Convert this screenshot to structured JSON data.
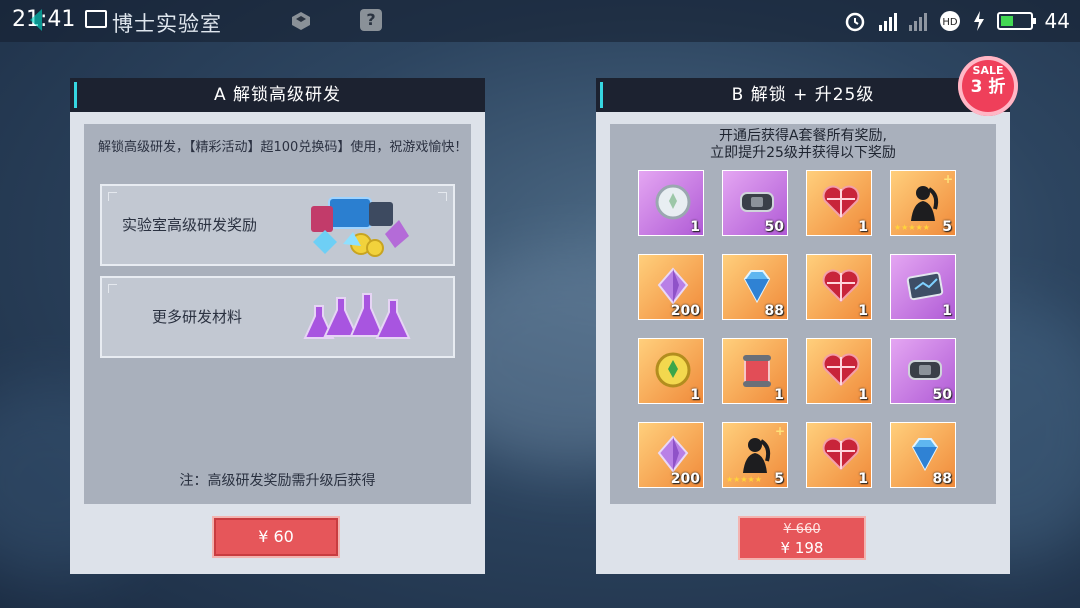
{
  "status_bar": {
    "time": "21:41",
    "app_title": "博士实验室",
    "battery": "44",
    "battery_level": 0.44
  },
  "panel_a": {
    "title": "A 解锁高级研发",
    "description": "解锁高级研发，【精彩活动】超100兑换码】使用，祝游戏愉快！",
    "rewards": [
      {
        "label": "实验室高级研发奖励"
      },
      {
        "label": "更多研发材料"
      }
    ],
    "note": "注：高级研发奖励需升级后获得",
    "price": "¥ 60"
  },
  "panel_b": {
    "title": "B 解锁 + 升25级",
    "description_line1": "开通后获得A套餐所有奖励,",
    "description_line2": "立即提升25级并获得以下奖励",
    "sale_label": "SALE",
    "sale_value": "3 折",
    "price_old": "¥ 660",
    "price_new": "¥ 198",
    "items": [
      {
        "icon": "silver-clover-coin-icon",
        "qty": "1",
        "bg": "purple"
      },
      {
        "icon": "gear-part-icon",
        "qty": "50",
        "bg": "purple"
      },
      {
        "icon": "heart-gift-box-icon",
        "qty": "1",
        "bg": "orange"
      },
      {
        "icon": "character-silhouette-icon",
        "qty": "5",
        "bg": "orange",
        "stars": "★★★★★"
      },
      {
        "icon": "purple-crystal-icon",
        "qty": "200",
        "bg": "orange"
      },
      {
        "icon": "blue-diamond-icon",
        "qty": "88",
        "bg": "orange"
      },
      {
        "icon": "heart-gift-box-icon",
        "qty": "1",
        "bg": "orange"
      },
      {
        "icon": "data-card-icon",
        "qty": "1",
        "bg": "purple"
      },
      {
        "icon": "gold-clover-coin-icon",
        "qty": "1",
        "bg": "orange"
      },
      {
        "icon": "scroll-icon",
        "qty": "1",
        "bg": "orange"
      },
      {
        "icon": "heart-gift-box-icon",
        "qty": "1",
        "bg": "orange"
      },
      {
        "icon": "gear-part-icon",
        "qty": "50",
        "bg": "purple"
      },
      {
        "icon": "purple-crystal-icon",
        "qty": "200",
        "bg": "orange"
      },
      {
        "icon": "character-silhouette-icon",
        "qty": "5",
        "bg": "orange",
        "stars": "★★★★★"
      },
      {
        "icon": "heart-gift-box-icon",
        "qty": "1",
        "bg": "orange"
      },
      {
        "icon": "blue-diamond-icon",
        "qty": "88",
        "bg": "orange"
      }
    ]
  }
}
